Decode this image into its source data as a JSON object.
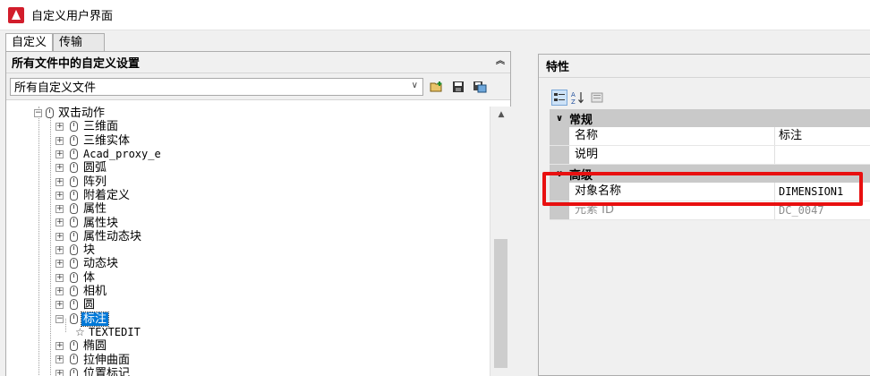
{
  "window": {
    "title": "自定义用户界面"
  },
  "tabs": [
    {
      "label": "自定义",
      "active": true
    },
    {
      "label": "传输",
      "active": false
    }
  ],
  "left_panel": {
    "header": "所有文件中的自定义设置",
    "file_select": {
      "value": "所有自定义文件"
    },
    "toolbar_icons": [
      "open-file-icon",
      "save-icon",
      "save-as-icon"
    ]
  },
  "tree": {
    "root": "双击动作",
    "items": [
      {
        "label": "三维面"
      },
      {
        "label": "三维实体"
      },
      {
        "label": "Acad_proxy_e"
      },
      {
        "label": "圆弧"
      },
      {
        "label": "阵列"
      },
      {
        "label": "附着定义"
      },
      {
        "label": "属性"
      },
      {
        "label": "属性块"
      },
      {
        "label": "属性动态块"
      },
      {
        "label": "块"
      },
      {
        "label": "动态块"
      },
      {
        "label": "体"
      },
      {
        "label": "相机"
      },
      {
        "label": "圆"
      },
      {
        "label": "标注",
        "selected": true,
        "expanded": true
      },
      {
        "label": "TEXTEDIT",
        "child": true
      },
      {
        "label": "椭圆"
      },
      {
        "label": "拉伸曲面"
      },
      {
        "label": "位置标记"
      }
    ]
  },
  "right_panel": {
    "header": "特性",
    "categories": [
      {
        "name": "常规",
        "rows": [
          {
            "name": "名称",
            "value": "标注"
          },
          {
            "name": "说明",
            "value": ""
          }
        ]
      },
      {
        "name": "高级",
        "rows": [
          {
            "name": "对象名称",
            "value": "DIMENSION1"
          },
          {
            "name": "元素 ID",
            "value": "DC_0047",
            "disabled": true
          }
        ]
      }
    ]
  },
  "colors": {
    "selection": "#0078d7",
    "highlight": "#e81010",
    "app_red": "#d21d2b"
  }
}
